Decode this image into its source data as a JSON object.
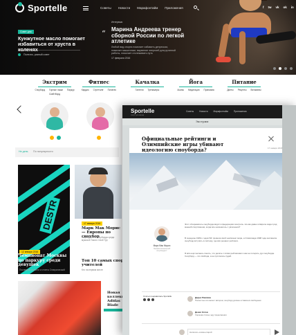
{
  "app": {
    "logo": "Sportelle",
    "overlay_logo": "Sportelle",
    "overlay_logo_sub": "спорт для жизни"
  },
  "nav": {
    "items": [
      "Советы",
      "Новости",
      "Марафонтайм",
      "Приложения"
    ]
  },
  "social": [
    "f",
    "tw",
    "vk",
    "ok",
    "in"
  ],
  "side_story": {
    "tag": "Совет дня",
    "headline": "Кунжутное масло помогает избавиться от хруста в коленях",
    "link": "Полезно, разный совет"
  },
  "hero": {
    "tag": "Интервью",
    "title": "Марина Андреева тренер сборной России по легкой атлетике",
    "text": "Любой вид спорта помогает избавить депрессии, помогает мышечным, вырвение энергией для рутинной работы, помогает отслеживать путь",
    "date": "17 февраля 2016",
    "slides": 4,
    "active_slide": 2
  },
  "categories": [
    {
      "name": "Экстрим",
      "subs": [
        "Сноуборд",
        "Горные лыжи",
        "Паркур",
        "Скейтборд"
      ]
    },
    {
      "name": "Фитнес",
      "subs": [
        "Кардио",
        "Стретчинг",
        "Пилатес"
      ]
    },
    {
      "name": "Качалка",
      "subs": [
        "Гантели",
        "Тренажеры"
      ]
    },
    {
      "name": "Йога",
      "subs": [
        "Асаны",
        "Медитация",
        "Пранаяма"
      ]
    },
    {
      "name": "Питание",
      "subs": [
        "Диеты",
        "Рецепты",
        "Витамины"
      ]
    }
  ],
  "tabs": {
    "active": "Не день",
    "other": "По популярности"
  },
  "left_news": [
    {
      "date": "12 января 2016",
      "title": "Чемпионат Москвы по паркуру среди девушек",
      "text": "Последние новости и отчеты Ставрогинский"
    },
    {
      "date": "",
      "title": "",
      "text": ""
    }
  ],
  "mid_news": [
    {
      "date": "17 января 2016",
      "title": "Марк Мак Морис — Европы по сноубор",
      "text": "За результаты сноуборда среди мужской Такого Свой Тур"
    },
    {
      "date": "",
      "title": "Топ 10 самых спор учителей",
      "text": "Кто на первом месте"
    }
  ],
  "shoe_card_text": "Новая коллекция Adidas Blade",
  "overlay": {
    "category": "Экстрим",
    "title": "Официальные рейтинги и Олимпийские игры убивают идеологию сноуборда?",
    "date": "17 января 2016",
    "author_name": "Марк Мак Морис",
    "author_role": "Профессиональный сноубордист",
    "paragraphs": [
      "Этот обозреватель сноуборда видит в федерациях контроль. Но как давно в Европе видел ряд мнений спортсменов, когда все начиналось с увлечения?",
      "В середине 1980-х годов ISF провела свой чемпионат мира, а Олимпиада 1998 года заставила сноуборд вступить в систему, где всё решают рейтинги.",
      "Я всё ещё пытаюсь понять, что делать с этими рейтингами и как не потерять дух сноуборда. Сноуборд — это свобода, а не протоколы судей."
    ],
    "share_label": "Статья понравилась Sportelle",
    "comments": [
      {
        "name": "Дарья Павлова",
        "text": "Полностью согласна с автором, сноуборд должен оставаться свободным"
      },
      {
        "name": "Денис Котов",
        "text": "Хорошая статья, жду продолжения"
      }
    ],
    "comment_placeholder": "Написать комментарий"
  }
}
